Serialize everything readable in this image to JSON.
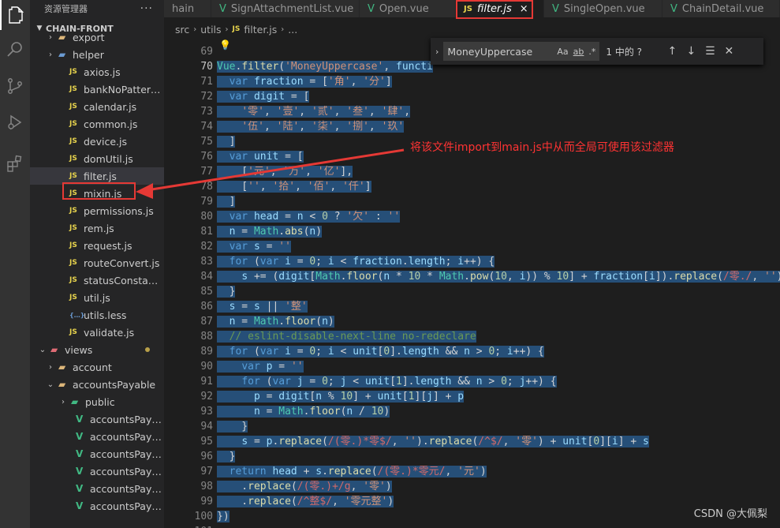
{
  "sidebar": {
    "title": "资源管理器",
    "menu": "···",
    "project": "CHAIN-FRONT",
    "items": [
      {
        "type": "folder",
        "label": "export",
        "indent": 1,
        "expanded": false
      },
      {
        "type": "folder",
        "label": "helper",
        "indent": 1,
        "expanded": false
      },
      {
        "type": "js",
        "label": "axios.js",
        "indent": 2
      },
      {
        "type": "js",
        "label": "bankNoPattern...",
        "indent": 2
      },
      {
        "type": "js",
        "label": "calendar.js",
        "indent": 2
      },
      {
        "type": "js",
        "label": "common.js",
        "indent": 2
      },
      {
        "type": "js",
        "label": "device.js",
        "indent": 2
      },
      {
        "type": "js",
        "label": "domUtil.js",
        "indent": 2
      },
      {
        "type": "js",
        "label": "filter.js",
        "indent": 2,
        "selected": true
      },
      {
        "type": "js",
        "label": "mixin.js",
        "indent": 2
      },
      {
        "type": "js",
        "label": "permissions.js",
        "indent": 2
      },
      {
        "type": "js",
        "label": "rem.js",
        "indent": 2
      },
      {
        "type": "js",
        "label": "request.js",
        "indent": 2
      },
      {
        "type": "js",
        "label": "routeConvert.js",
        "indent": 2
      },
      {
        "type": "js",
        "label": "statusConstant.js",
        "indent": 2
      },
      {
        "type": "js",
        "label": "util.js",
        "indent": 2
      },
      {
        "type": "less",
        "label": "utils.less",
        "indent": 2
      },
      {
        "type": "js",
        "label": "validate.js",
        "indent": 2
      },
      {
        "type": "folder-open",
        "label": "views",
        "indent": 0,
        "expanded": true,
        "modified": true
      },
      {
        "type": "folder",
        "label": "account",
        "indent": 1,
        "expanded": false
      },
      {
        "type": "folder-open",
        "label": "accountsPayable",
        "indent": 1,
        "expanded": true
      },
      {
        "type": "folder",
        "label": "public",
        "indent": 2,
        "expanded": false
      },
      {
        "type": "vue",
        "label": "accountsPaya...",
        "indent": 3
      },
      {
        "type": "vue",
        "label": "accountsPaya...",
        "indent": 3
      },
      {
        "type": "vue",
        "label": "accountsPaya...",
        "indent": 3
      },
      {
        "type": "vue",
        "label": "accountsPaya...",
        "indent": 3
      },
      {
        "type": "vue",
        "label": "accountsPaya...",
        "indent": 3
      },
      {
        "type": "vue",
        "label": "accountsPaya...",
        "indent": 3
      }
    ]
  },
  "tabs": [
    {
      "label": "hain",
      "icon": "none"
    },
    {
      "label": "SignAttachmentList.vue",
      "icon": "vue"
    },
    {
      "label": "Open.vue",
      "icon": "vue"
    },
    {
      "label": "filter.js",
      "icon": "js",
      "active": true,
      "close": "×"
    },
    {
      "label": "SingleOpen.vue",
      "icon": "vue"
    },
    {
      "label": "ChainDetail.vue",
      "icon": "vue"
    }
  ],
  "breadcrumb": [
    "src",
    "utils",
    "filter.js",
    "..."
  ],
  "find": {
    "query": "MoneyUppercase",
    "opt_case": "Aa",
    "opt_word": "ab",
    "opt_regex": ".*",
    "count": "1 中的 ?"
  },
  "editor": {
    "first_line": 69,
    "current_line": 70,
    "lines": [
      "",
      "Vue.filter('MoneyUppercase', functi",
      "  var fraction = ['角', '分']",
      "  var digit = [",
      "    '零', '壹', '贰', '叁', '肆',",
      "    '伍', '陆', '柒', '捌', '玖'",
      "  ]",
      "  var unit = [",
      "    ['元', '万', '亿'],",
      "    ['', '拾', '佰', '仟']",
      "  ]",
      "  var head = n < 0 ? '欠' : ''",
      "  n = Math.abs(n)",
      "  var s = ''",
      "  for (var i = 0; i < fraction.length; i++) {",
      "    s += (digit[Math.floor(n * 10 * Math.pow(10, i)) % 10] + fraction[i]).replace(/零./, '')",
      "  }",
      "  s = s || '整'",
      "  n = Math.floor(n)",
      "  // eslint-disable-next-line no-redeclare",
      "  for (var i = 0; i < unit[0].length && n > 0; i++) {",
      "    var p = ''",
      "    for (var j = 0; j < unit[1].length && n > 0; j++) {",
      "      p = digit[n % 10] + unit[1][j] + p",
      "      n = Math.floor(n / 10)",
      "    }",
      "    s = p.replace(/(零.)*零$/, '').replace(/^$/, '零') + unit[0][i] + s",
      "  }",
      "  return head + s.replace(/(零.)*零元/, '元')",
      "    .replace(/(零.)+/g, '零')",
      "    .replace(/^整$/, '零元整')",
      "})",
      ""
    ]
  },
  "annotation": "将该文件import到main.js中从而全局可使用该过滤器",
  "watermark": "CSDN @大佩梨",
  "colors": {
    "annotation": "#e53935",
    "selection": "#264f78",
    "string": "#ce9178",
    "keyword": "#569cd6",
    "variable": "#9cdcfe",
    "function": "#dcdcaa",
    "number": "#b5cea8",
    "comment": "#6a9955",
    "regex": "#d16969"
  }
}
